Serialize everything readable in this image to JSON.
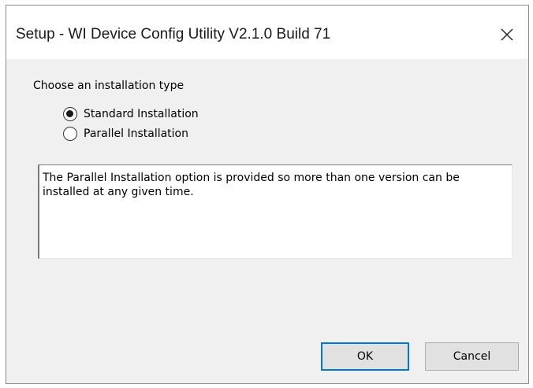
{
  "window": {
    "title": "Setup - WI Device Config Utility V2.1.0 Build 71",
    "close_icon": "close-icon"
  },
  "install_type": {
    "label": "Choose an installation type",
    "options": [
      {
        "label": "Standard Installation",
        "selected": true
      },
      {
        "label": "Parallel Installation",
        "selected": false
      }
    ]
  },
  "description": "The Parallel Installation option is provided so more than one version can be installed at any given time.",
  "buttons": {
    "ok": "OK",
    "cancel": "Cancel"
  },
  "colors": {
    "dialog_background": "#f0f0f0",
    "default_button_border": "#0078d7"
  }
}
